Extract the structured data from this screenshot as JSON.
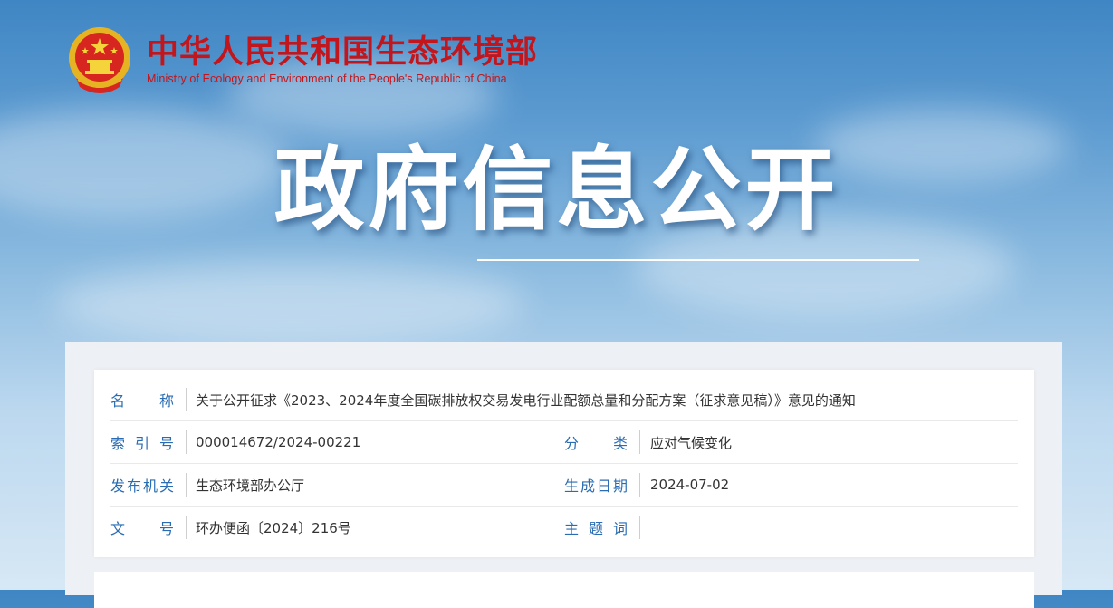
{
  "header": {
    "site_name_cn": "中华人民共和国生态环境部",
    "site_name_en": "Ministry of Ecology and Environment of the People's Republic of China",
    "emblem_icon": "national-emblem-icon"
  },
  "banner": {
    "title": "政府信息公开"
  },
  "info": {
    "name_label": "名称",
    "name_value": "关于公开征求《2023、2024年度全国碳排放权交易发电行业配额总量和分配方案（征求意见稿）》意见的通知",
    "index_label": "索引号",
    "index_value": "000014672/2024-00221",
    "category_label": "分类",
    "category_value": "应对气候变化",
    "issuer_label": "发布机关",
    "issuer_value": "生态环境部办公厅",
    "date_label": "生成日期",
    "date_value": "2024-07-02",
    "doc_no_label": "文号",
    "doc_no_value": "环办便函〔2024〕216号",
    "keywords_label": "主题词",
    "keywords_value": ""
  },
  "colors": {
    "brand_red": "#c3161c",
    "label_blue": "#2a6cb3"
  }
}
